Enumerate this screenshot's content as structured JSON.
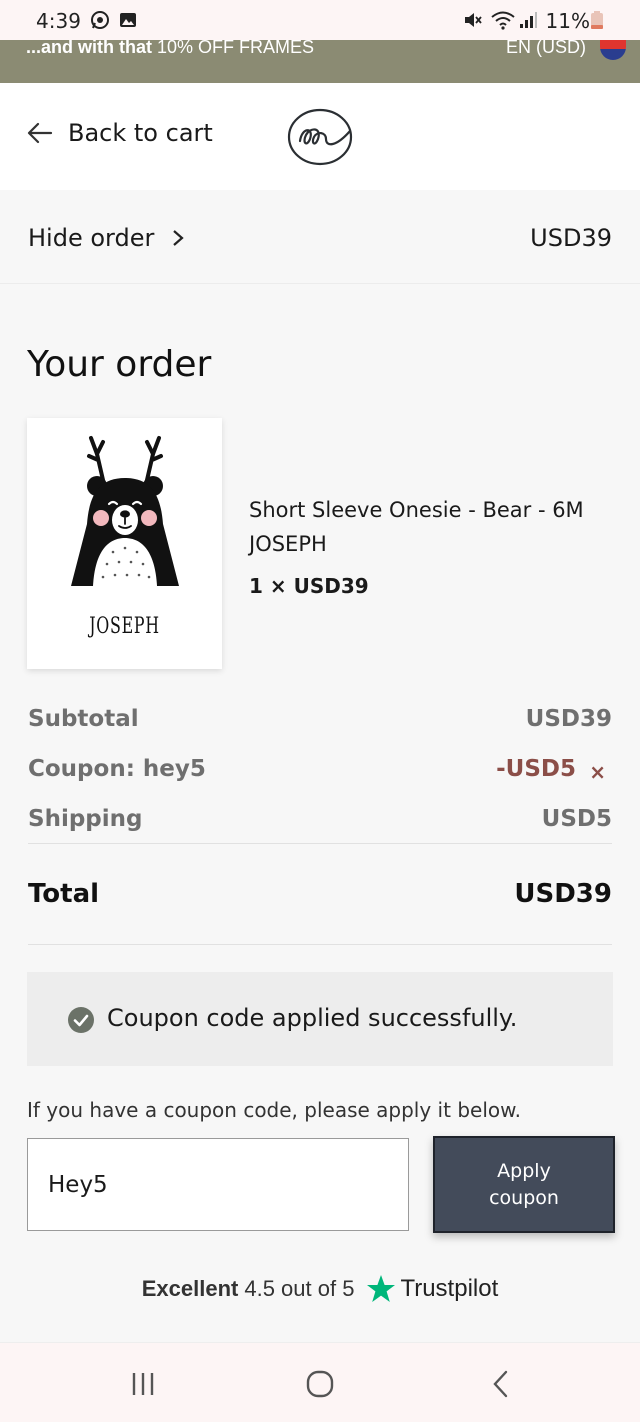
{
  "status_bar": {
    "time": "4:39",
    "battery": "11%"
  },
  "promo": {
    "lead": "...and with that",
    "rest": " 10% OFF FRAMES",
    "language": "EN (USD)"
  },
  "header": {
    "back_label": "Back to cart"
  },
  "summary": {
    "toggle_label": "Hide order",
    "total": "USD39"
  },
  "order": {
    "heading": "Your order",
    "item": {
      "image_name": "JOSEPH",
      "title": "Short Sleeve Onesie - Bear - 6M",
      "personalization": "JOSEPH",
      "qty_price": "1 × USD39"
    }
  },
  "totals": {
    "subtotal_label": "Subtotal",
    "subtotal_value": "USD39",
    "coupon_label": "Coupon: hey5",
    "coupon_value": "-USD5",
    "coupon_remove": "×",
    "shipping_label": "Shipping",
    "shipping_value": "USD5",
    "total_label": "Total",
    "total_value": "USD39"
  },
  "notice": {
    "message": "Coupon code applied successfully."
  },
  "coupon_form": {
    "hint": "If you have a coupon code, please apply it below.",
    "input_value": "Hey5",
    "button_line1": "Apply",
    "button_line2": "coupon"
  },
  "trustpilot": {
    "label": "Excellent",
    "rating": "4.5 out of 5",
    "brand": "Trustpilot"
  },
  "colors": {
    "banner": "#8b8b73",
    "button": "#434b5a",
    "coupon_discount": "#8b4e48",
    "check": "#6b7268",
    "trustpilot_star": "#00b67a"
  },
  "icons": [
    "whatsapp-icon",
    "gallery-icon",
    "mute-icon",
    "wifi-icon",
    "signal-icon",
    "battery-icon",
    "flag-icon",
    "back-arrow-icon",
    "logo-icon",
    "chevron-right-icon",
    "check-circle-icon",
    "trustpilot-star-icon",
    "recent-apps-icon",
    "home-icon",
    "back-nav-icon"
  ]
}
